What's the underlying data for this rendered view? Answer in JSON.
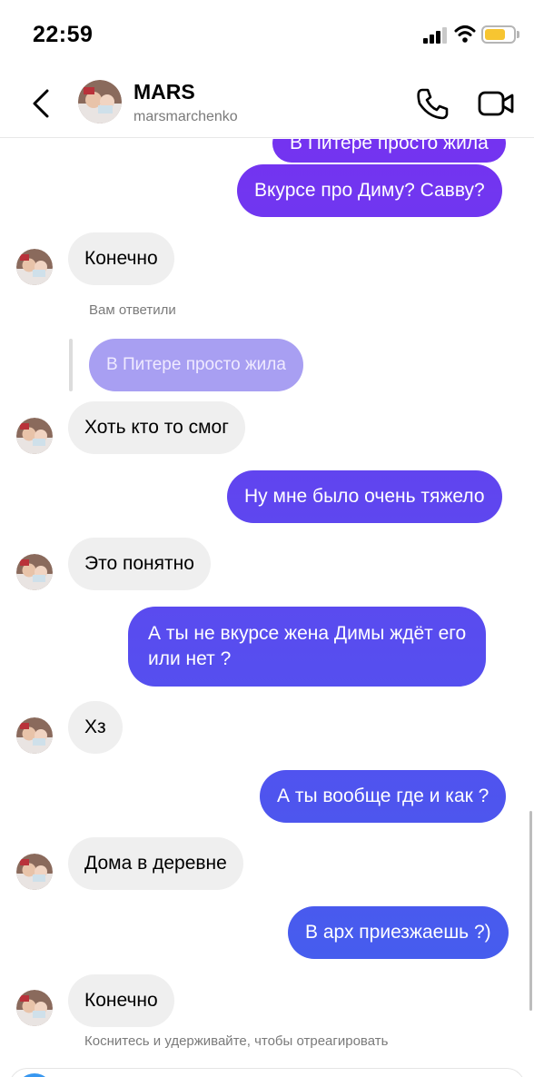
{
  "status_bar": {
    "time": "22:59"
  },
  "header": {
    "contact_name": "MARS",
    "contact_handle": "marsmarchenko"
  },
  "messages": [
    {
      "id": "m0",
      "side": "out",
      "text": "В Питере просто жила"
    },
    {
      "id": "m1",
      "side": "out",
      "text": "Вкурсе про Диму? Савву?"
    },
    {
      "id": "m2",
      "side": "in",
      "text": "Конечно"
    },
    {
      "id": "m3",
      "side": "in",
      "text": "Хоть кто то смог"
    },
    {
      "id": "m4",
      "side": "out",
      "text": "Ну мне было очень тяжело"
    },
    {
      "id": "m5",
      "side": "in",
      "text": "Это понятно"
    },
    {
      "id": "m6",
      "side": "out",
      "line1": "А ты не вкурсе жена Димы ждёт его",
      "line2": "или нет ?"
    },
    {
      "id": "m7",
      "side": "in",
      "text": "Хз"
    },
    {
      "id": "m8",
      "side": "out",
      "text": "А ты вообще где и как ?"
    },
    {
      "id": "m9",
      "side": "in",
      "text": "Дома в деревне"
    },
    {
      "id": "m10",
      "side": "out",
      "text": "В арх приезжаешь ?)"
    },
    {
      "id": "m11",
      "side": "in",
      "text": "Конечно"
    }
  ],
  "reply": {
    "label": "Вам ответили",
    "quoted_text": "В Питере просто жила"
  },
  "hint": "Коснитесь и удерживайте, чтобы отреагировать",
  "colors": {
    "gradient_top": "#7c2cf0",
    "gradient_bottom": "#3f63ee",
    "incoming_bubble": "#efefef",
    "quoted_bubble": "#a89ff2",
    "battery": "#f7c531"
  },
  "icons": {
    "back": "chevron-left-icon",
    "call": "phone-icon",
    "video": "video-camera-icon",
    "signal": "cellular-signal-icon",
    "wifi": "wifi-icon",
    "battery": "battery-icon"
  }
}
